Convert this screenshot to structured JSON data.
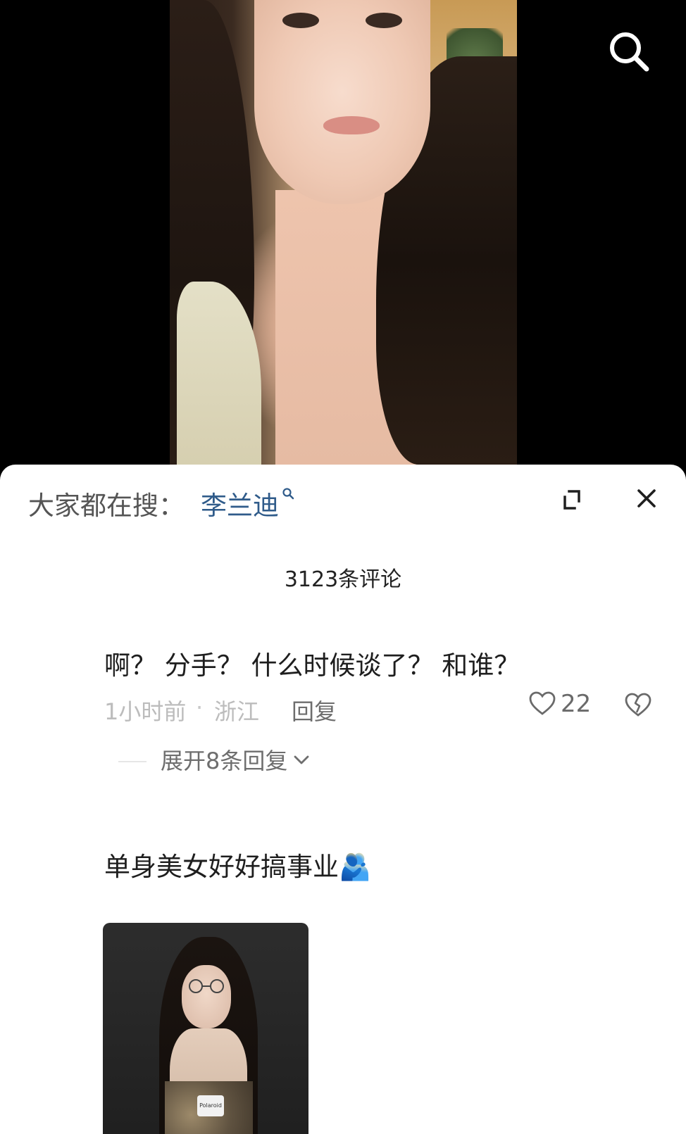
{
  "video": {
    "search_icon": "search-icon"
  },
  "panel": {
    "hot_search_label": "大家都在搜：",
    "hot_search_term": "李兰迪",
    "comment_count": "3123条评论"
  },
  "comments": [
    {
      "text": "啊？ 分手？ 什么时候谈了？ 和谁？",
      "time": "1小时前",
      "dot": "·",
      "location": "浙江",
      "reply_label": "回复",
      "likes": "22",
      "expand_replies_label": "展开8条回复"
    },
    {
      "text": "单身美女好好搞事业🫂",
      "image_caption": "Polaroid"
    }
  ],
  "colors": {
    "accent_link": "#2f5b8a",
    "panel_bg": "#ffffff",
    "video_bg": "#000000"
  }
}
